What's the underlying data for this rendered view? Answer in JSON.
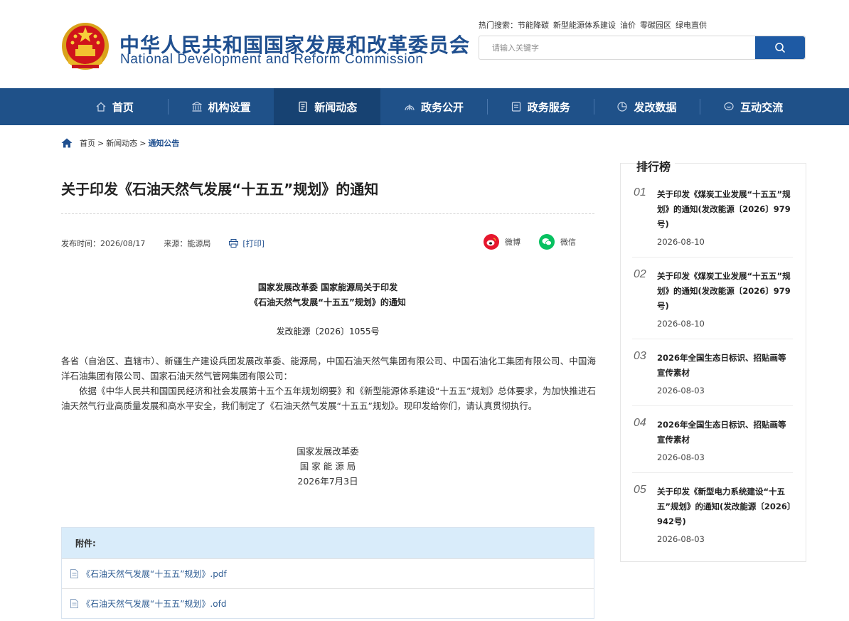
{
  "header": {
    "site_name_cn": "中华人民共和国国家发展和改革委员会",
    "site_name_en": "National Development and Reform Commission",
    "hot_search_label": "热门搜索：",
    "hot_search_terms": [
      "节能降碳",
      "新型能源体系建设",
      "油价",
      "零碳园区",
      "绿电直供"
    ],
    "search_placeholder": "请输入关键字"
  },
  "nav": {
    "items": [
      {
        "label": "首页",
        "icon": "home-icon"
      },
      {
        "label": "机构设置",
        "icon": "institution-icon"
      },
      {
        "label": "新闻动态",
        "icon": "news-icon",
        "active": true
      },
      {
        "label": "政务公开",
        "icon": "open-gov-icon"
      },
      {
        "label": "政务服务",
        "icon": "service-icon"
      },
      {
        "label": "发改数据",
        "icon": "data-icon"
      },
      {
        "label": "互动交流",
        "icon": "chat-icon"
      }
    ]
  },
  "breadcrumb": {
    "home": "首页",
    "sep": ">",
    "news": "新闻动态",
    "current": "通知公告"
  },
  "article": {
    "title": "关于印发《石油天然气发展“十五五”规划》的通知",
    "publish_time": "发布时间：2026/08/17",
    "source": "来源：能源局",
    "print_label": "[打印]",
    "share_weibo": "微博",
    "share_wechat": "微信",
    "doc_title_line1": "国家发展改革委 国家能源局关于印发",
    "doc_title_line2": "《石油天然气发展“十五五”规划》的通知",
    "doc_number": "发改能源〔2026〕1055号",
    "addressee": "各省（自治区、直辖市）、新疆生产建设兵团发展改革委、能源局，中国石油天然气集团有限公司、中国石油化工集团有限公司、中国海洋石油集团有限公司、国家石油天然气管网集团有限公司：",
    "paragraph": "依据《中华人民共和国国民经济和社会发展第十五个五年规划纲要》和《新型能源体系建设“十五五”规划》总体要求，为加快推进石油天然气行业高质量发展和高水平安全，我们制定了《石油天然气发展“十五五”规划》。现印发给你们，请认真贯彻执行。",
    "sign_org1": "国家发展改革委",
    "sign_org2": "国 家 能 源 局",
    "sign_date": "2026年7月3日"
  },
  "attachments": {
    "label": "附件:",
    "files": [
      "《石油天然气发展“十五五”规划》.pdf",
      "《石油天然气发展“十五五”规划》.ofd"
    ]
  },
  "ranking": {
    "title": "排行榜",
    "items": [
      {
        "num": "01",
        "text": "关于印发《煤炭工业发展“十五五”规划》的通知(发改能源〔2026〕979号)",
        "date": "2026-08-10"
      },
      {
        "num": "02",
        "text": "关于印发《煤炭工业发展“十五五”规划》的通知(发改能源〔2026〕979号)",
        "date": "2026-08-10"
      },
      {
        "num": "03",
        "text": "2026年全国生态日标识、招贴画等宣传素材",
        "date": "2026-08-03"
      },
      {
        "num": "04",
        "text": "2026年全国生态日标识、招贴画等宣传素材",
        "date": "2026-08-03"
      },
      {
        "num": "05",
        "text": "关于印发《新型电力系统建设“十五五”规划》的通知(发改能源〔2026〕942号)",
        "date": "2026-08-03"
      }
    ]
  },
  "colors": {
    "nav_bg": "#1f5189",
    "nav_active": "#174272",
    "brand_blue": "#1f4f8f",
    "weibo_red": "#e6162d",
    "wechat_green": "#07c160",
    "attach_head_bg": "#d9ecfa"
  }
}
